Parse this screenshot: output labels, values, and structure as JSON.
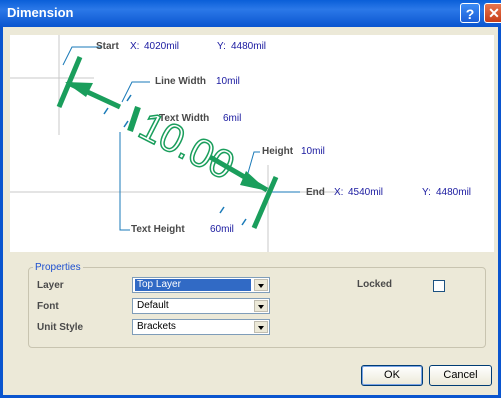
{
  "window": {
    "title": "Dimension"
  },
  "diagram": {
    "start": {
      "label": "Start",
      "x_label": "X:",
      "x": "4020mil",
      "y_label": "Y:",
      "y": "4480mil"
    },
    "end": {
      "label": "End",
      "x_label": "X:",
      "x": "4540mil",
      "y_label": "Y:",
      "y": "4480mil"
    },
    "line_width": {
      "label": "Line Width",
      "value": "10mil"
    },
    "text_width": {
      "label": "Text Width",
      "value": "6mil"
    },
    "height": {
      "label": "Height",
      "value": "10mil"
    },
    "text_height": {
      "label": "Text Height",
      "value": "60mil"
    },
    "dimension_text": "10.00",
    "colors": {
      "dimension": "#1a9e5c",
      "measure_lines": "#1a7ab8",
      "text": "#1a1aa0"
    }
  },
  "properties": {
    "legend": "Properties",
    "layer": {
      "label": "Layer",
      "value": "Top Layer"
    },
    "font": {
      "label": "Font",
      "value": "Default"
    },
    "unit_style": {
      "label": "Unit Style",
      "value": "Brackets"
    },
    "locked": {
      "label": "Locked",
      "checked": false
    }
  },
  "buttons": {
    "ok": "OK",
    "cancel": "Cancel"
  }
}
